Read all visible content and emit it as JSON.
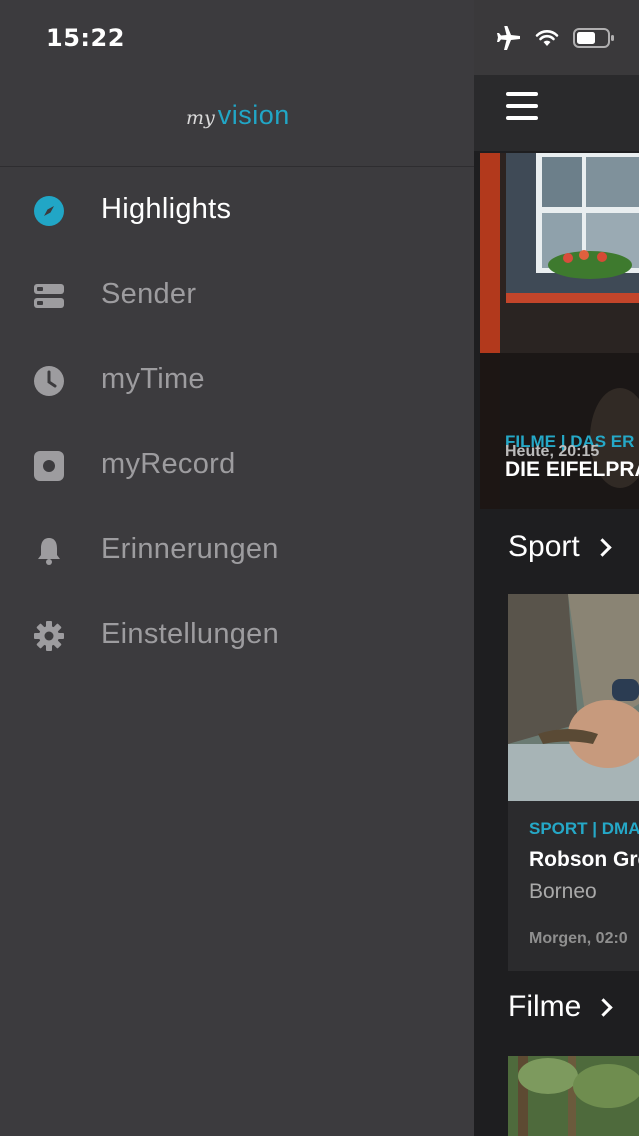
{
  "status_bar": {
    "time": "15:22"
  },
  "logo": {
    "my": "my",
    "vision": "vision"
  },
  "menu": {
    "items": [
      {
        "label": "Highlights",
        "icon": "compass-icon",
        "active": true
      },
      {
        "label": "Sender",
        "icon": "list-icon",
        "active": false
      },
      {
        "label": "myTime",
        "icon": "clock-icon",
        "active": false
      },
      {
        "label": "myRecord",
        "icon": "record-icon",
        "active": false
      },
      {
        "label": "Erinnerungen",
        "icon": "bell-icon",
        "active": false
      },
      {
        "label": "Einstellungen",
        "icon": "gear-icon",
        "active": false
      }
    ]
  },
  "hero": {
    "category": "FILME | DAS ER",
    "title": "DIE EIFELPRA",
    "datetime": "Heute, 20:15"
  },
  "sections": {
    "sport": "Sport",
    "filme": "Filme"
  },
  "sport_card": {
    "category": "SPORT | DMA",
    "title": "Robson Gre",
    "subtitle": "Borneo",
    "datetime": "Morgen, 02:0"
  },
  "colors": {
    "accent": "#21a6c6",
    "drawer_bg": "#3c3b3e",
    "main_bg": "#1e1e20"
  }
}
